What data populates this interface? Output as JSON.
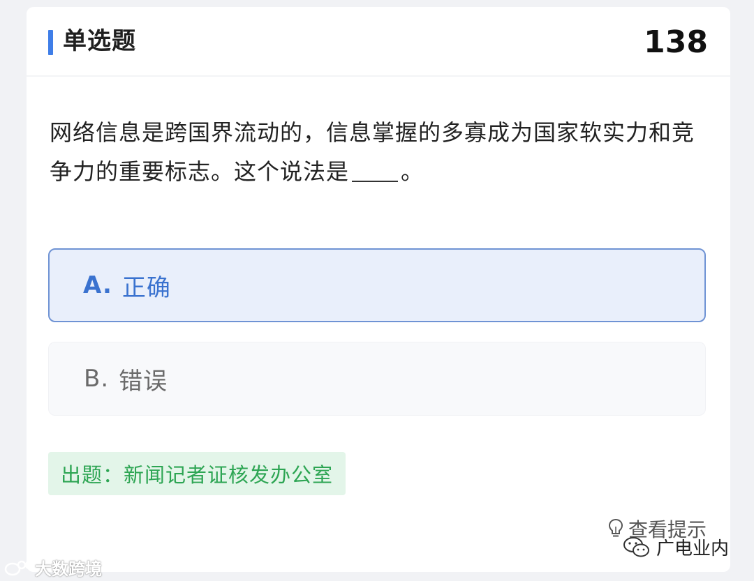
{
  "header": {
    "title": "单选题",
    "question_number": "138"
  },
  "question": {
    "text_before_blank": "网络信息是跨国界流动的，信息掌握的多寡成为国家软实力和竞争力的重要标志。这个说法是",
    "text_after_blank": "。"
  },
  "options": [
    {
      "letter": "A.",
      "label": "正确",
      "selected": true
    },
    {
      "letter": "B.",
      "label": "错误",
      "selected": false
    }
  ],
  "source": {
    "text": "出题：新闻记者证核发办公室"
  },
  "hint": {
    "label": "查看提示",
    "icon": "lightbulb-icon"
  },
  "watermarks": {
    "left_text": "大数跨境",
    "right_text": "广电业内",
    "right_icon": "wechat-icon"
  },
  "colors": {
    "accent": "#3f7ee8",
    "selected_border": "#6f93d4",
    "selected_bg": "#e9effb",
    "source_green": "#2da553",
    "source_bg": "#e3f5e9"
  }
}
